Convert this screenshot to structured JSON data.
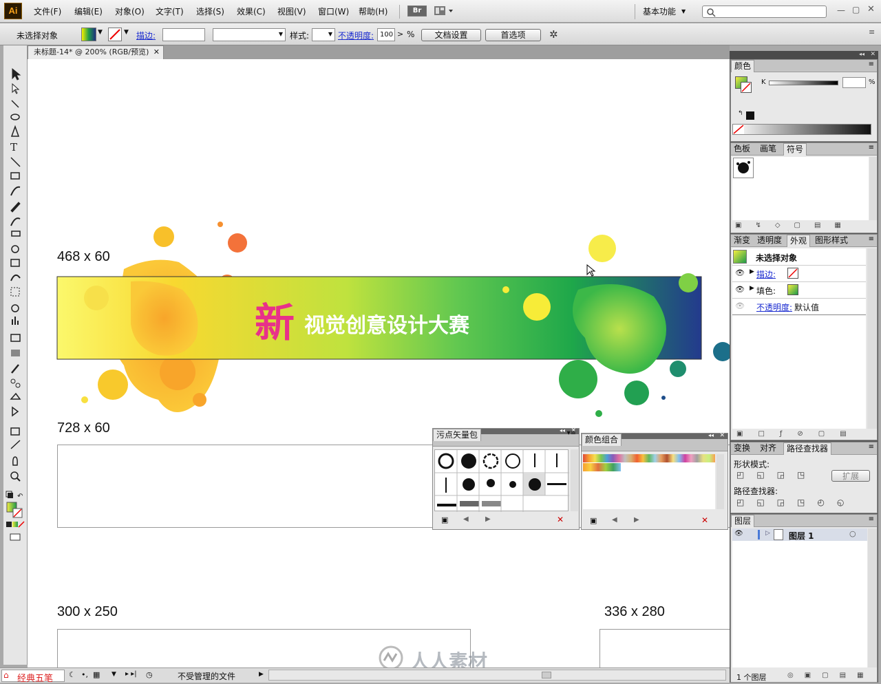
{
  "app": {
    "logo": "Ai",
    "workspace": "基本功能"
  },
  "menu": [
    "文件(F)",
    "编辑(E)",
    "对象(O)",
    "文字(T)",
    "选择(S)",
    "效果(C)",
    "视图(V)",
    "窗口(W)",
    "帮助(H)"
  ],
  "bridge": "Br",
  "control": {
    "selection": "未选择对象",
    "stroke_label": "描边:",
    "style_label": "样式:",
    "opacity_label": "不透明度:",
    "opacity_value": "100",
    "percent": "%",
    "doc_setup": "文档设置",
    "preferences": "首选项"
  },
  "document": {
    "tab": "未标题-14* @ 200% (RGB/预览)"
  },
  "artboards": [
    {
      "label": "468 x 60"
    },
    {
      "label": "728 x 60"
    },
    {
      "label": "300 x 250"
    },
    {
      "label": "336 x 280"
    }
  ],
  "banner": {
    "big_char": "新",
    "text": "视觉创意设计大赛"
  },
  "color_panel": {
    "title": "颜色",
    "channel": "K",
    "percent": "%"
  },
  "swatch_tabs": [
    "色板",
    "画笔",
    "符号"
  ],
  "appearance": {
    "tabs": [
      "渐变",
      "透明度",
      "外观",
      "图形样式"
    ],
    "title": "未选择对象",
    "stroke": "描边:",
    "fill": "填色:",
    "opacity": "不透明度:",
    "opacity_value": "默认值"
  },
  "pathfinder": {
    "tabs": [
      "变换",
      "对齐",
      "路径查找器"
    ],
    "shape_modes": "形状模式:",
    "expand": "扩展",
    "pathfinders": "路径查找器:"
  },
  "layers": {
    "tab": "图层",
    "layer_name": "图层 1",
    "count": "1 个图层"
  },
  "splat_panel": {
    "title": "污点矢量包"
  },
  "color_group_panel": {
    "title": "颜色组合"
  },
  "status": {
    "ime": "经典五笔",
    "file_state": "不受管理的文件"
  },
  "watermark": "人人素材",
  "colors": {
    "accent_magenta": "#e8318a",
    "banner_left": "#fbf56c",
    "banner_mid": "#3cbf4c",
    "banner_right": "#243a8c",
    "orange": "#f7a020"
  }
}
